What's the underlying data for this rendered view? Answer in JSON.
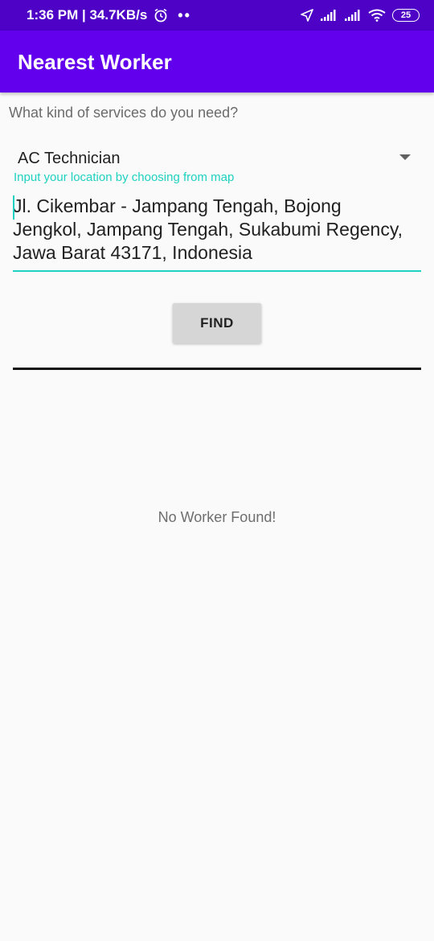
{
  "status_bar": {
    "time": "1:36 PM | 34.7KB/s",
    "dots": "••",
    "battery": "25",
    "icons": [
      "alarm-icon",
      "location-arrow-icon",
      "signal-icon",
      "signal-icon",
      "wifi-icon",
      "battery-icon"
    ]
  },
  "app_bar": {
    "title": "Nearest Worker",
    "color": "#6200ee"
  },
  "form": {
    "question": "What kind of services do you need?",
    "service_selected": "AC Technician",
    "location_hint": "Input your location by choosing from map",
    "address": "Jl. Cikembar - Jampang Tengah, Bojong Jengkol, Jampang Tengah, Sukabumi Regency, Jawa Barat 43171, Indonesia",
    "accent_color": "#1fd1c0",
    "find_label": "FIND"
  },
  "results": {
    "empty_message": "No Worker Found!"
  }
}
